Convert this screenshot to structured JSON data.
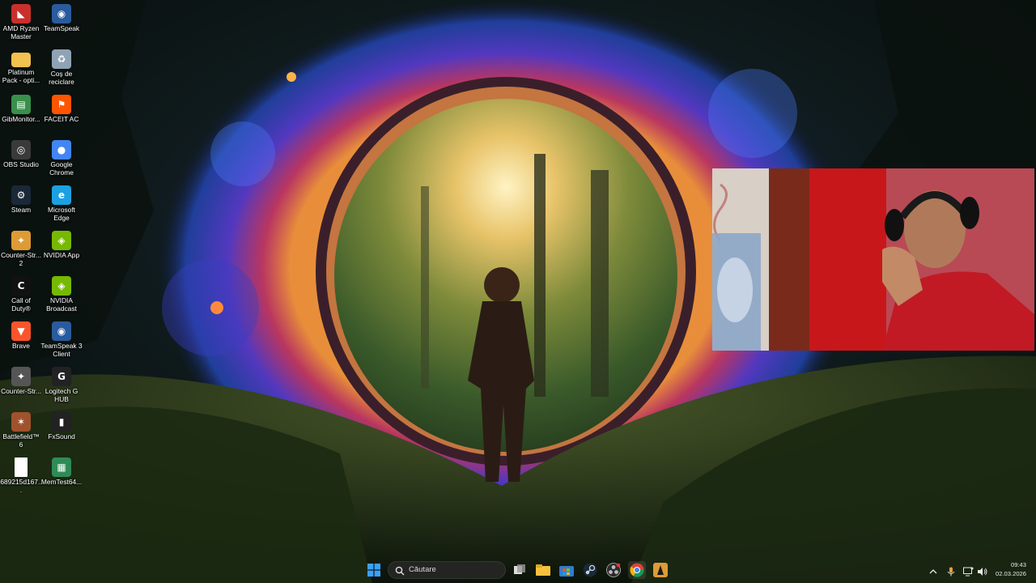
{
  "desktop": {
    "icons": [
      {
        "label": "AMD Ryzen\nMaster",
        "icon": "amd-ryzen-icon",
        "color": "#c9302c"
      },
      {
        "label": "TeamSpeak",
        "icon": "teamspeak-icon",
        "color": "#2a5b9e"
      },
      {
        "label": "Platinum\nPack - opti...",
        "icon": "folder-icon",
        "color": "#f2c14e"
      },
      {
        "label": "Coș de\nreciclare",
        "icon": "recycle-bin-icon",
        "color": "#8fa3b5"
      },
      {
        "label": "GibMonitor...",
        "icon": "gibmonitor-icon",
        "color": "#3a8f4a"
      },
      {
        "label": "FACEIT AC",
        "icon": "faceit-icon",
        "color": "#ff5500"
      },
      {
        "label": "OBS Studio",
        "icon": "obs-icon",
        "color": "#3a3a3a"
      },
      {
        "label": "Google\nChrome",
        "icon": "chrome-icon",
        "color": "#4285f4"
      },
      {
        "label": "Steam",
        "icon": "steam-icon",
        "color": "#1b2838"
      },
      {
        "label": "Microsoft\nEdge",
        "icon": "edge-icon",
        "color": "#1ba1e2"
      },
      {
        "label": "Counter-Str...\n2",
        "icon": "cs2-icon",
        "color": "#de9b35"
      },
      {
        "label": "NVIDIA App",
        "icon": "nvidia-icon",
        "color": "#76b900"
      },
      {
        "label": "Call of\nDuty®",
        "icon": "call-of-duty-icon",
        "color": "#111111"
      },
      {
        "label": "NVIDIA\nBroadcast",
        "icon": "nvidia-broadcast-icon",
        "color": "#76b900"
      },
      {
        "label": "Brave",
        "icon": "brave-icon",
        "color": "#fb542b"
      },
      {
        "label": "TeamSpeak 3\nClient",
        "icon": "teamspeak3-icon",
        "color": "#2a5b9e"
      },
      {
        "label": "Counter-Str...",
        "icon": "cs-icon",
        "color": "#555555"
      },
      {
        "label": "Logitech G\nHUB",
        "icon": "logitech-ghub-icon",
        "color": "#222222"
      },
      {
        "label": "Battlefield™ 6",
        "icon": "battlefield-icon",
        "color": "#a0522d"
      },
      {
        "label": "FxSound",
        "icon": "fxsound-icon",
        "color": "#222222"
      },
      {
        "label": "689215d167...",
        "icon": "file-icon",
        "color": "#ffffff"
      },
      {
        "label": "MemTest64...",
        "icon": "memtest-icon",
        "color": "#2e8b57"
      }
    ]
  },
  "taskbar": {
    "search_placeholder": "Căutare",
    "pinned": [
      {
        "name": "task-view-icon"
      },
      {
        "name": "file-explorer-icon"
      },
      {
        "name": "store-icon"
      },
      {
        "name": "steam-icon"
      },
      {
        "name": "obs-icon"
      },
      {
        "name": "chrome-icon"
      },
      {
        "name": "cs2-icon"
      }
    ],
    "tray": {
      "time": "09:43",
      "date": "02.03.2026"
    }
  },
  "colors": {
    "accent": "#0078d4",
    "portal_outer": "#3b4fd6",
    "portal_glow": "#ff8a3c"
  }
}
